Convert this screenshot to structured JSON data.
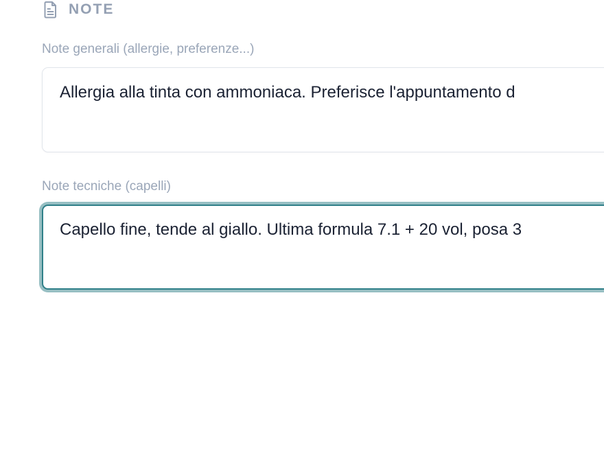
{
  "notes_section": {
    "title": "NOTE",
    "icon": "document-icon"
  },
  "general_notes": {
    "label": "Note generali (allergie, preferenze...)",
    "value": "Allergia alla tinta con ammoniaca. Preferisce l'appuntamento d"
  },
  "technical_notes": {
    "label": "Note tecniche (capelli)",
    "value": "Capello fine, tende al giallo. Ultima formula 7.1 + 20 vol, posa 3",
    "focused": true,
    "focus_color": "#2f7f88"
  }
}
